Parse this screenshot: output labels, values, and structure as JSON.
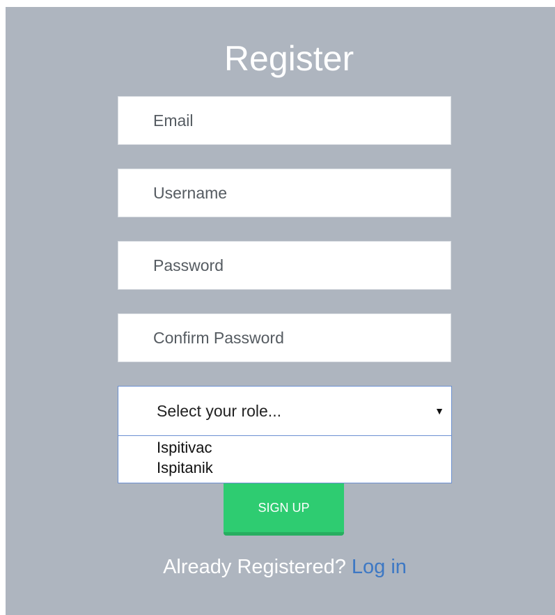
{
  "form": {
    "title": "Register",
    "email_placeholder": "Email",
    "username_placeholder": "Username",
    "password_placeholder": "Password",
    "confirm_placeholder": "Confirm Password",
    "role_select": {
      "selected": "Select your role...",
      "options": [
        "Ispitivac",
        "Ispitanik"
      ]
    },
    "submit_label": "SIGN UP",
    "login_prompt": "Already Registered?",
    "login_link": "Log in"
  },
  "colors": {
    "panel_background": "#aeb5bf",
    "button": "#2ecc71",
    "link": "#3d78c4"
  }
}
